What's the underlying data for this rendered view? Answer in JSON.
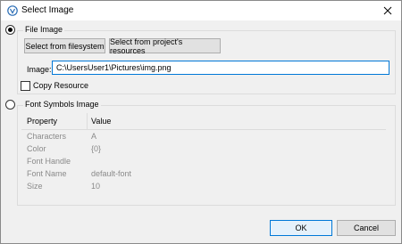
{
  "window": {
    "title": "Select Image",
    "icon": "app-logo-icon",
    "close_icon": "close-icon"
  },
  "file_image": {
    "label": "File Image",
    "selected": true,
    "buttons": {
      "filesystem": "Select from filesystem",
      "resources": "Select from project's resources"
    },
    "image_label": "Image:",
    "image_value": "C:\\UsersUser1\\Pictures\\img.png",
    "copy_resource_label": "Copy Resource",
    "copy_resource_checked": false
  },
  "font_symbols": {
    "label": "Font Symbols Image",
    "selected": false,
    "table": {
      "headers": [
        "Property",
        "Value"
      ],
      "rows": [
        {
          "property": "Characters",
          "value": "A"
        },
        {
          "property": "Color",
          "value": "{0}"
        },
        {
          "property": "Font Handle",
          "value": ""
        },
        {
          "property": "Font Name",
          "value": "default-font"
        },
        {
          "property": "Size",
          "value": "10"
        }
      ]
    }
  },
  "footer": {
    "ok_label": "OK",
    "cancel_label": "Cancel"
  }
}
